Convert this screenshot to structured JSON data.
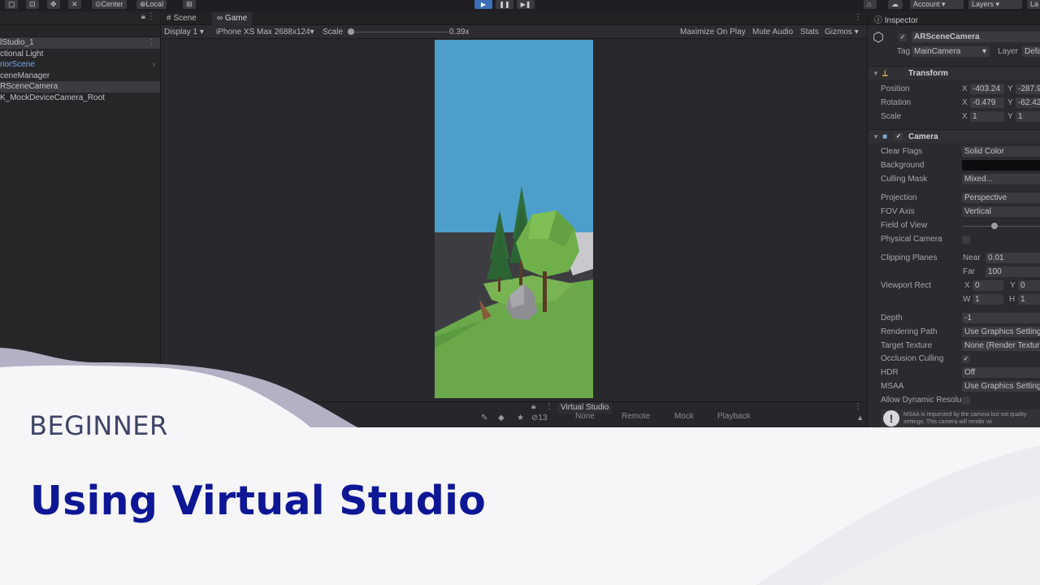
{
  "toolbar": {
    "center_label": "Center",
    "local_label": "Local",
    "account_label": "Account",
    "layers_label": "Layers",
    "layout_label": "La"
  },
  "hierarchy": {
    "items": [
      {
        "label": "lStudio_1",
        "selected": true
      },
      {
        "label": "ctional Light",
        "selected": false
      },
      {
        "label": "riorScene",
        "selected": false,
        "prefab": true
      },
      {
        "label": "ceneManager",
        "selected": false
      },
      {
        "label": "RSceneCamera",
        "selected": true
      },
      {
        "label": "K_MockDeviceCamera_Root",
        "selected": false
      }
    ]
  },
  "game": {
    "tabs": [
      {
        "label": "Scene",
        "active": false
      },
      {
        "label": "Game",
        "active": true
      }
    ],
    "display": "Display 1",
    "resolution": "iPhone XS Max 2688x124",
    "scale_label": "Scale",
    "scale_value": "0.39x",
    "maximize": "Maximize On Play",
    "mute": "Mute Audio",
    "stats": "Stats",
    "gizmos": "Gizmos"
  },
  "virtual_studio": {
    "tab_label": "Virtual Studio",
    "badge_count": "13",
    "modes": [
      "None",
      "Remote",
      "Mock",
      "Playback"
    ]
  },
  "inspector": {
    "tab_label": "Inspector",
    "object_name": "ARSceneCamera",
    "tag_label": "Tag",
    "tag_value": "MainCamera",
    "layer_label": "Layer",
    "layer_value": "Defa",
    "transform": {
      "header": "Transform",
      "position_label": "Position",
      "position_x": "-403.24",
      "position_y": "-287.9",
      "rotation_label": "Rotation",
      "rotation_x": "-0.479",
      "rotation_y": "-62.42",
      "scale_label": "Scale",
      "scale_x": "1",
      "scale_y": "1"
    },
    "camera": {
      "header": "Camera",
      "rows": [
        {
          "label": "Clear Flags",
          "value": "Solid Color"
        },
        {
          "label": "Background",
          "value": ""
        },
        {
          "label": "Culling Mask",
          "value": "Mixed..."
        },
        {
          "label": "Projection",
          "value": "Perspective"
        },
        {
          "label": "FOV Axis",
          "value": "Vertical"
        },
        {
          "label": "Field of View",
          "value": ""
        },
        {
          "label": "Physical Camera",
          "value": ""
        },
        {
          "label": "Clipping Planes",
          "value": ""
        },
        {
          "label": "Viewport Rect",
          "value": ""
        },
        {
          "label": "Depth",
          "value": "-1"
        },
        {
          "label": "Rendering Path",
          "value": "Use Graphics Setting"
        },
        {
          "label": "Target Texture",
          "value": "None (Render Textur"
        },
        {
          "label": "Occlusion Culling",
          "value": ""
        },
        {
          "label": "HDR",
          "value": "Off"
        },
        {
          "label": "MSAA",
          "value": "Use Graphics Setting"
        },
        {
          "label": "Allow Dynamic Resolu",
          "value": ""
        }
      ],
      "near_label": "Near",
      "near_value": "0.01",
      "far_label": "Far",
      "far_value": "100",
      "vp_x_label": "X",
      "vp_x": "0",
      "vp_y_label": "Y",
      "vp_y": "0",
      "vp_w_label": "W",
      "vp_w": "1",
      "vp_h_label": "H",
      "vp_h": "1",
      "warning": "MSAA is requested by the camera but not quality settings. This camera will render wi"
    }
  },
  "course": {
    "level": "BEGINNER",
    "title": "Using Virtual Studio"
  },
  "colors": {
    "title": "#0d1796",
    "level": "#3f4466",
    "sky": "#4e9fcb",
    "grass": "#6aa84a",
    "play_active": "#3b6fb8"
  }
}
